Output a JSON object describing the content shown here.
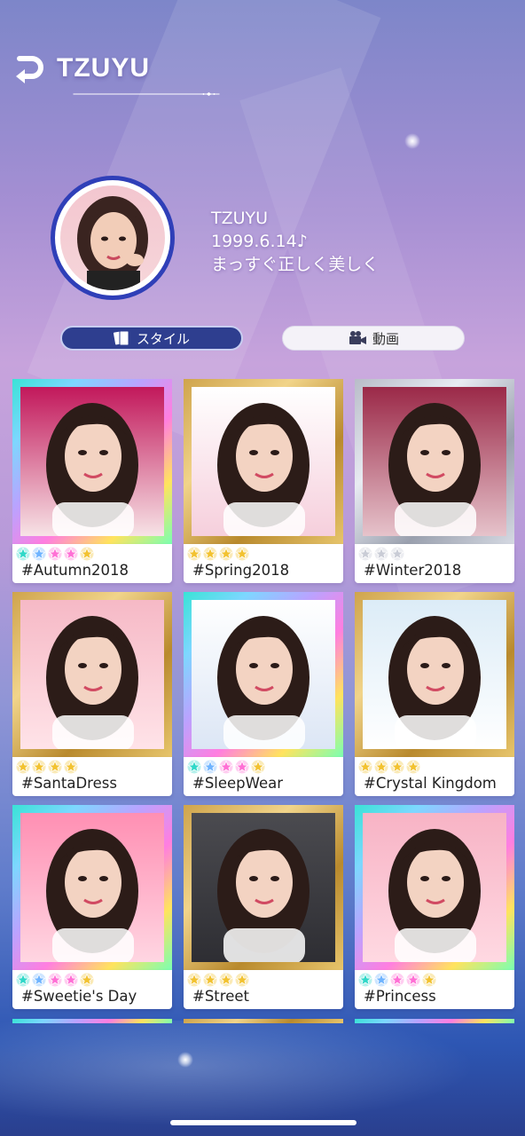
{
  "header": {
    "title": "TZUYU"
  },
  "profile": {
    "name": "TZUYU",
    "birthday": "1999.6.14♪",
    "motto": "まっすぐ正しく美しく"
  },
  "tabs": [
    {
      "label": "スタイル",
      "icon": "cards-icon",
      "active": true
    },
    {
      "label": "動画",
      "icon": "video-camera-icon",
      "active": false
    }
  ],
  "cards": [
    {
      "name": "#Autumn2018",
      "frame": "rainbow",
      "stars": [
        "teal",
        "blue",
        "pink",
        "pink",
        "gold"
      ]
    },
    {
      "name": "#Spring2018",
      "frame": "gold",
      "stars": [
        "gold",
        "gold",
        "gold",
        "gold"
      ]
    },
    {
      "name": "#Winter2018",
      "frame": "silver",
      "stars": [
        "silver",
        "silver",
        "silver"
      ]
    },
    {
      "name": "#SantaDress",
      "frame": "gold",
      "stars": [
        "gold",
        "gold",
        "gold",
        "gold"
      ]
    },
    {
      "name": "#SleepWear",
      "frame": "rainbow",
      "stars": [
        "teal",
        "blue",
        "pink",
        "pink",
        "gold"
      ]
    },
    {
      "name": "#Crystal Kingdom",
      "frame": "gold",
      "stars": [
        "gold",
        "gold",
        "gold",
        "gold"
      ]
    },
    {
      "name": "#Sweetie's Day",
      "frame": "rainbow",
      "stars": [
        "teal",
        "blue",
        "pink",
        "pink",
        "gold"
      ]
    },
    {
      "name": "#Street",
      "frame": "gold",
      "stars": [
        "gold",
        "gold",
        "gold",
        "gold"
      ]
    },
    {
      "name": "#Princess",
      "frame": "rainbow",
      "stars": [
        "teal",
        "blue",
        "pink",
        "pink",
        "gold"
      ]
    }
  ],
  "colors": {
    "accent": "#2e3e8f",
    "gold": "#f2c230",
    "teal": "#2fd8c8",
    "blue": "#6fb4ff",
    "pink": "#ff6fd5",
    "silver": "#c9ccd6"
  }
}
